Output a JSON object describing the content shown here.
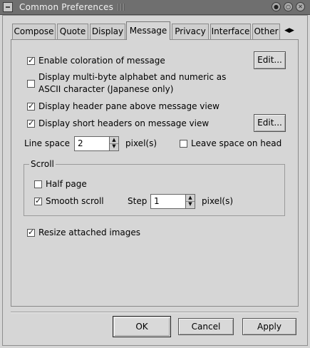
{
  "window": {
    "title": "Common Preferences",
    "buttons": [
      {
        "icon": "minimize-icon",
        "glyph": "●"
      },
      {
        "icon": "maximize-icon",
        "glyph": "○"
      },
      {
        "icon": "close-icon",
        "glyph": "✕"
      }
    ]
  },
  "tabs": [
    {
      "label": "Compose"
    },
    {
      "label": "Quote"
    },
    {
      "label": "Display"
    },
    {
      "label": "Message",
      "active": true
    },
    {
      "label": "Privacy"
    },
    {
      "label": "Interface"
    },
    {
      "label": "Other"
    }
  ],
  "tab_scroll": {
    "left_glyph": "◀",
    "right_glyph": "▶"
  },
  "message": {
    "enable_coloration": {
      "label": "Enable coloration of message",
      "checked": true
    },
    "edit_button_1": "Edit...",
    "multibyte": {
      "line1": "Display multi-byte alphabet and numeric as",
      "line2": "ASCII character (Japanese only)",
      "checked": false
    },
    "header_pane": {
      "label": "Display header pane above message view",
      "checked": true
    },
    "short_headers": {
      "label": "Display short headers on message view",
      "checked": true
    },
    "edit_button_2": "Edit...",
    "line_space": {
      "label": "Line space",
      "value": "2",
      "unit": "pixel(s)"
    },
    "leave_space": {
      "label": "Leave space on head",
      "checked": false
    },
    "scroll": {
      "title": "Scroll",
      "half_page": {
        "label": "Half page",
        "checked": false
      },
      "smooth_scroll": {
        "label": "Smooth scroll",
        "checked": true
      },
      "step": {
        "label": "Step",
        "value": "1",
        "unit": "pixel(s)"
      }
    },
    "resize_images": {
      "label": "Resize attached images",
      "checked": true
    }
  },
  "buttons": {
    "ok": "OK",
    "cancel": "Cancel",
    "apply": "Apply"
  }
}
